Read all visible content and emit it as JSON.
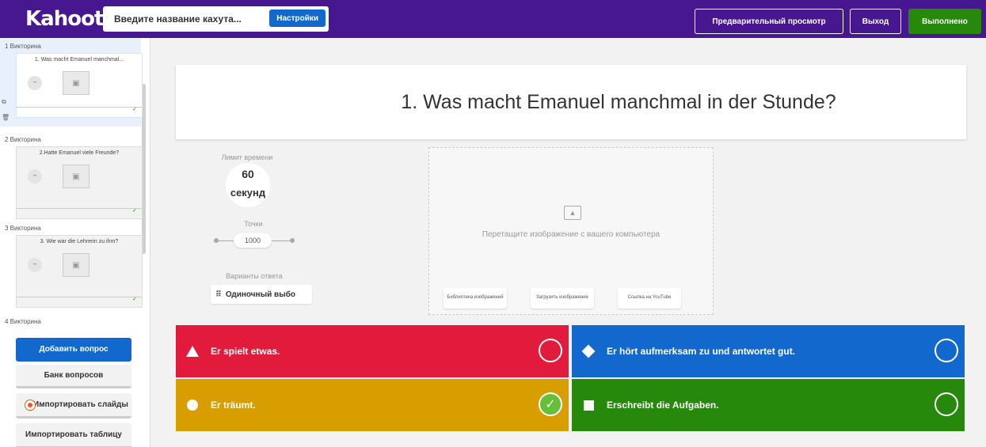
{
  "header": {
    "logo": "Kahoot!",
    "title_placeholder": "Введите название кахута...",
    "settings_label": "Настройки",
    "preview_label": "Предварительный просмотр",
    "exit_label": "Выход",
    "done_label": "Выполнено"
  },
  "sidebar": {
    "slides": [
      {
        "label": "1 Викторина",
        "question": "1. Was macht Emanuel manchmal..."
      },
      {
        "label": "2 Викторина",
        "question": "2.Hatte Emanuel viele Freunde?"
      },
      {
        "label": "3 Викторина",
        "question": "3. Wie war die Lehrerin zu ihm?"
      },
      {
        "label": "4 Викторина"
      }
    ],
    "add_question": "Добавить вопрос",
    "question_bank": "Банк вопросов",
    "import_slides": "Импортировать слайды",
    "import_table": "Импортировать таблицу"
  },
  "question": {
    "text": "1. Was macht Emanuel manchmal in der Stunde?"
  },
  "settings_panel": {
    "time_limit_label": "Лимит времени",
    "time_value": "60",
    "time_unit": "секунд",
    "points_label": "Точки",
    "points_value": "1000",
    "answer_options_label": "Варианты ответа",
    "answer_type": "Одиночный выбо"
  },
  "media": {
    "drop_text": "Перетащите изображение с вашего компьютера",
    "image_library": "Библиотека изображений",
    "upload_image": "Загрузить изображение",
    "youtube_link": "Ссылка на YouTube"
  },
  "answers": [
    {
      "text": "Er spielt etwas.",
      "color": "#e21b3c",
      "shape": "triangle",
      "correct": false
    },
    {
      "text": "Er hört aufmerksam zu und antwortet gut.",
      "color": "#1368ce",
      "shape": "diamond",
      "correct": false
    },
    {
      "text": "Er träumt.",
      "color": "#d89e00",
      "shape": "circle",
      "correct": true
    },
    {
      "text": "Erschreibt die Aufgaben.",
      "color": "#26890c",
      "shape": "square",
      "correct": false
    }
  ]
}
